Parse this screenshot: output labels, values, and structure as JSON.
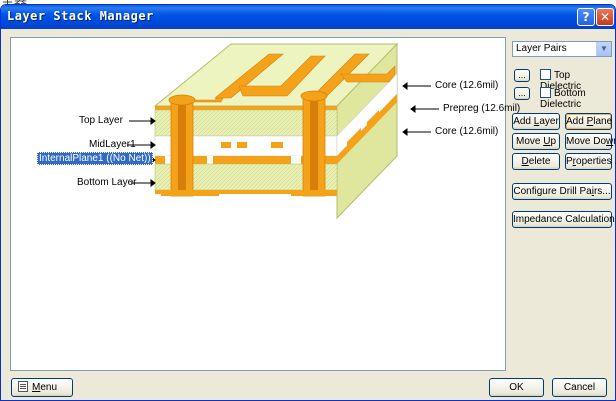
{
  "window": {
    "title": "Layer Stack Manager",
    "help_glyph": "?",
    "close_glyph": "✕",
    "top_strip_glyph": "主器"
  },
  "diagram": {
    "left_labels": {
      "top_layer": "Top Layer",
      "mid_layer": "MidLayer1",
      "internal_plane": "InternalPlane1 ((No Net))",
      "bottom_layer": "Bottom Layer"
    },
    "right_labels": {
      "core_top": "Core (12.6mil)",
      "prepreg": "Prepreg (12.6mil)",
      "core_bottom": "Core (12.6mil)"
    },
    "colors": {
      "dielectric": "#e8f0b0",
      "copper": "#f4a21a",
      "copper_dark": "#d77f0a",
      "plane_cut": "#ffffff"
    }
  },
  "side_panel": {
    "layer_pairs_select": "Layer Pairs",
    "top_dielectric": {
      "ellipsis": "...",
      "label": "Top Dielectric",
      "checked": false
    },
    "bottom_dielectric": {
      "ellipsis": "...",
      "label": "Bottom Dielectric",
      "checked": false
    },
    "add_layer": {
      "pre": "Add ",
      "key": "L",
      "post": "ayer"
    },
    "add_plane": {
      "pre": "Add ",
      "key": "P",
      "post": "lane"
    },
    "move_up": {
      "pre": "Move ",
      "key": "U",
      "post": "p"
    },
    "move_down": {
      "pre": "Move Do",
      "key": "w",
      "post": "n"
    },
    "delete": {
      "pre": "",
      "key": "D",
      "post": "elete"
    },
    "properties": {
      "pre": "P",
      "key": "r",
      "post": "operties ..."
    },
    "configure_drill_pairs": {
      "pre": "Configure Drill Pa",
      "key": "i",
      "post": "rs..."
    },
    "impedance_calculation": "Impedance Calculation..."
  },
  "footer": {
    "menu": {
      "pre": "",
      "key": "M",
      "post": "enu"
    },
    "ok": "OK",
    "cancel": "Cancel"
  }
}
